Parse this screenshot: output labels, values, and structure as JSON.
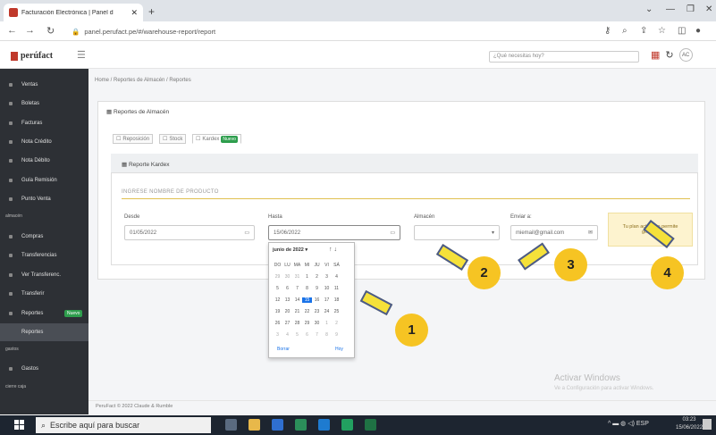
{
  "browser": {
    "tab_title": "Facturación Electrónica | Panel d",
    "url": "panel.perufact.pe/#/warehouse-report/report"
  },
  "app": {
    "logo": "perúfact",
    "search_placeholder": "¿Qué necesitas hoy?"
  },
  "sidebar": {
    "items": [
      "Ventas",
      "Boletas",
      "Facturas",
      "Nota Crédito",
      "Nota Débito",
      "Guía Remisión",
      "Punto Venta"
    ],
    "section_almacen": "almacén",
    "almacen_items": [
      "Compras",
      "Transferencias",
      "Ver Transferenc.",
      "Transferir",
      "Reportes",
      "Reportes"
    ],
    "nuevo_badge": "Nuevo",
    "section_gastos": "gastos",
    "gastos_items": [
      "Gastos"
    ],
    "section_caja": "cierre caja"
  },
  "breadcrumb": "Home / Reportes de Almacén / Reportes",
  "reports_card": {
    "title": "Reportes de Almacén",
    "options": [
      "Reposición",
      "Stock",
      "Kardex"
    ],
    "nuevo_badge": "Nuevo"
  },
  "kardex_card": {
    "title": "Reporte Kardex",
    "product_label": "INGRESE NOMBRE DE PRODUCTO",
    "desde_label": "Desde",
    "desde_value": "01/05/2022",
    "hasta_label": "Hasta",
    "hasta_value": "15/06/2022",
    "almacen_label": "Almacén",
    "enviar_label": "Enviar a:",
    "enviar_value": "miemail@gmail.com",
    "warning": "Tu plan actual no permite generar"
  },
  "calendar": {
    "month": "junio de 2022",
    "weekdays": [
      "DO",
      "LU",
      "MA",
      "MI",
      "JU",
      "VI",
      "SÁ"
    ],
    "weeks": [
      [
        "29",
        "30",
        "31",
        "1",
        "2",
        "3",
        "4"
      ],
      [
        "5",
        "6",
        "7",
        "8",
        "9",
        "10",
        "11"
      ],
      [
        "12",
        "13",
        "14",
        "15",
        "16",
        "17",
        "18"
      ],
      [
        "19",
        "20",
        "21",
        "22",
        "23",
        "24",
        "25"
      ],
      [
        "26",
        "27",
        "28",
        "29",
        "30",
        "1",
        "2"
      ],
      [
        "3",
        "4",
        "5",
        "6",
        "7",
        "8",
        "9"
      ]
    ],
    "selected": "15",
    "clear": "Borrar",
    "today": "Hoy"
  },
  "footer": "PeruFact © 2022 Claude & Rumble",
  "watermark": {
    "line1": "Activar Windows",
    "line2": "Ve a Configuración para activar Windows."
  },
  "annotations": [
    "1",
    "2",
    "3",
    "4"
  ],
  "taskbar": {
    "search": "Escribe aquí para buscar",
    "time": "03:23",
    "date": "15/06/2022"
  },
  "colors": {
    "sidebar": "#2d3035",
    "accent": "#1a73e8",
    "badge": "#2e9e4d",
    "annotation": "#f6c423"
  }
}
